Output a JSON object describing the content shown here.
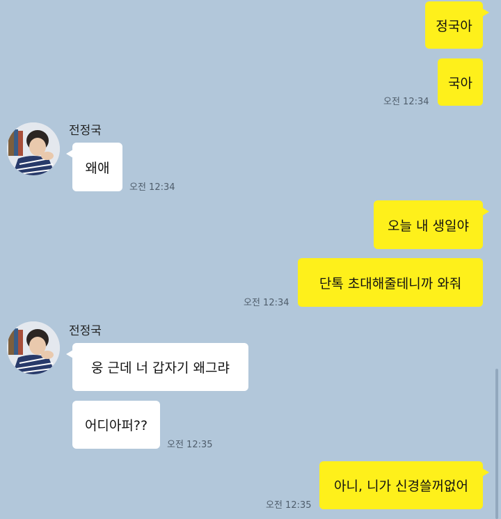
{
  "colors": {
    "background": "#b2c7da",
    "my_bubble": "#fef01b",
    "their_bubble": "#ffffff"
  },
  "sender": "전정국",
  "messages": {
    "m1": "정국아",
    "m2": "국아",
    "t1": "오전 12:34",
    "m3": "왜애",
    "t2": "오전 12:34",
    "m4": "오늘 내 생일야",
    "m5": "단톡 초대해줄테니까 와줘",
    "t3": "오전 12:34",
    "m6": "웅 근데 너 갑자기 왜그랴",
    "m7": "어디아퍼??",
    "t4": "오전 12:35",
    "m8": "아니, 니가 신경쓸꺼없어",
    "t5": "오전 12:35"
  }
}
